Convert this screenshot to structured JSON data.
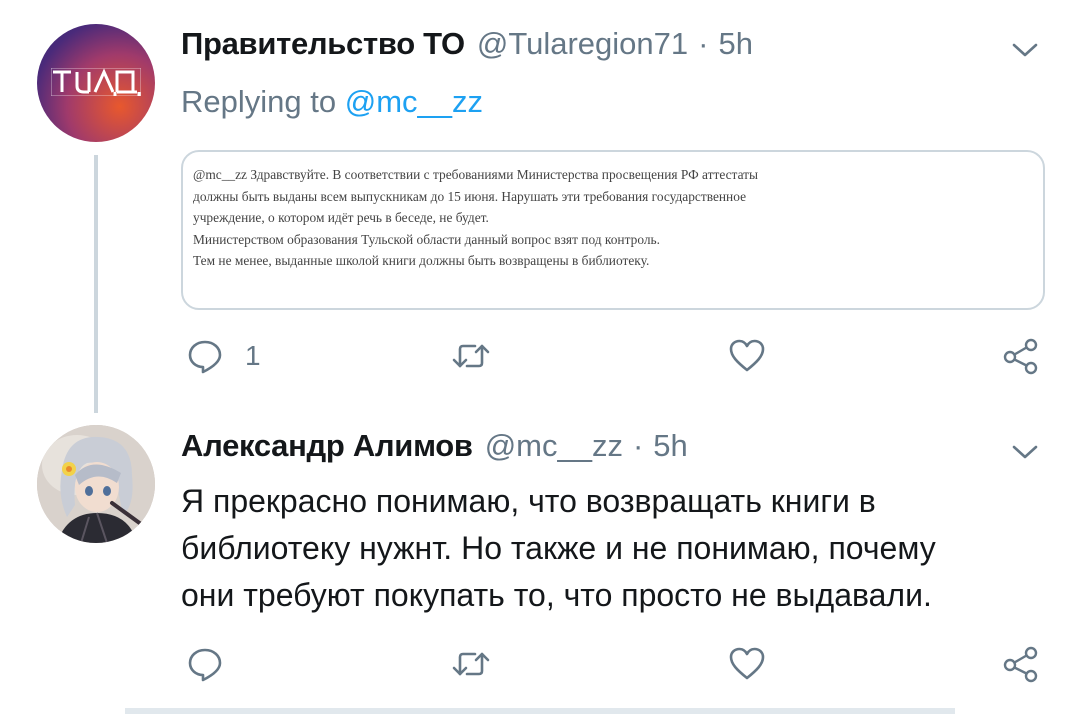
{
  "tweets": [
    {
      "author": "Правительство ТО",
      "handle": "@Tularegion71",
      "separator": "·",
      "time": "5h",
      "avatar_logo": "ТУЛА",
      "replying_prefix": "Replying to",
      "replying_handle": "@mc__zz",
      "quoted_image_lines": [
        "@mc__zz Здравствуйте. В соответствии с требованиями Министерства просвещения РФ аттестаты",
        "должны быть выданы всем выпускникам до 15 июня. Нарушать эти требования государственное",
        "учреждение, о котором идёт речь в беседе, не будет.",
        "Министерством образования Тульской области данный вопрос взят под контроль.",
        "Тем не менее, выданные школой книги должны быть возвращены в библиотеку."
      ],
      "reply_count": "1"
    },
    {
      "author": "Александр Алимов",
      "handle": "@mc__zz",
      "separator": "·",
      "time": "5h",
      "text_lines": [
        "Я прекрасно понимаю, что возвращать книги в",
        "библиотеку нужнт. Но также и не понимаю, почему",
        "они требуют покупать то, что просто не выдавали."
      ]
    }
  ],
  "icons": {
    "reply": "reply-icon",
    "retweet": "retweet-icon",
    "like": "like-icon",
    "share": "share-icon",
    "more": "chevron-down-icon"
  },
  "colors": {
    "link": "#1da1f2",
    "muted": "#657786",
    "border": "#ccd6dd"
  }
}
